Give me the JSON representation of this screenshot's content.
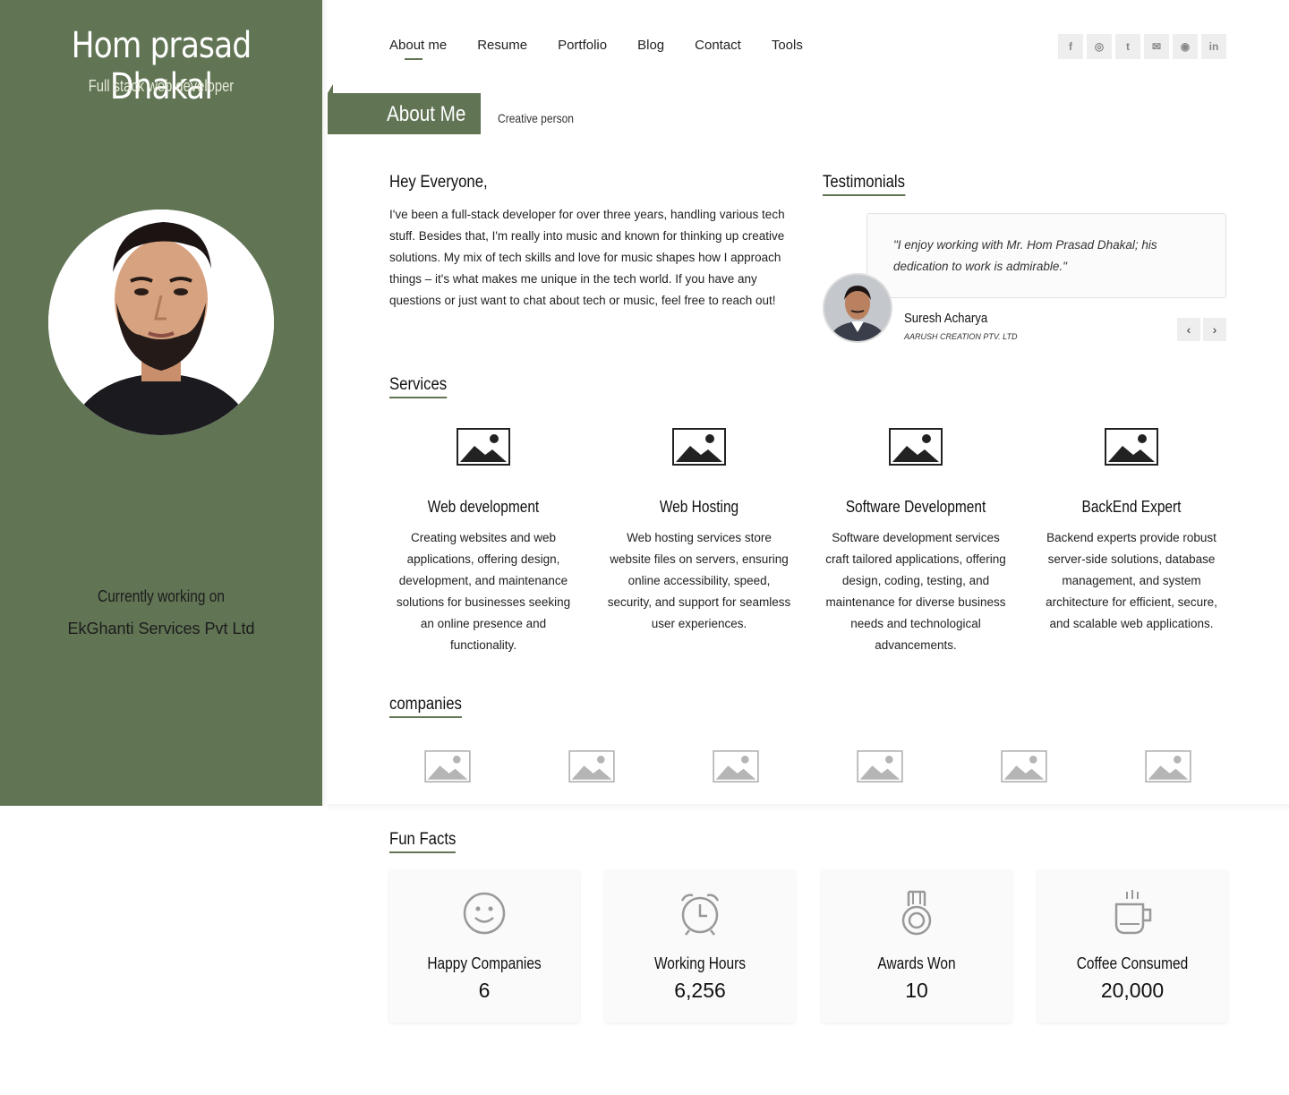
{
  "sidebar": {
    "name": "Hom prasad Dhakal",
    "role": "Full stack web developer",
    "work_label": "Currently working on",
    "work_company": "EkGhanti Services Pvt Ltd"
  },
  "nav": {
    "items": [
      {
        "label": "About me",
        "active": true
      },
      {
        "label": "Resume"
      },
      {
        "label": "Portfolio"
      },
      {
        "label": "Blog"
      },
      {
        "label": "Contact"
      },
      {
        "label": "Tools"
      }
    ]
  },
  "social": [
    {
      "icon": "facebook-icon",
      "glyph": "f"
    },
    {
      "icon": "instagram-icon",
      "glyph": "◎"
    },
    {
      "icon": "twitter-icon",
      "glyph": "t"
    },
    {
      "icon": "email-icon",
      "glyph": "✉"
    },
    {
      "icon": "github-icon",
      "glyph": "◉"
    },
    {
      "icon": "linkedin-icon",
      "glyph": "in"
    }
  ],
  "banner": {
    "title": "About Me",
    "subtitle": "Creative person"
  },
  "intro": {
    "heading": "Hey Everyone,",
    "text": "I've been a full-stack developer for over three years, handling various tech stuff. Besides that, I'm really into music and known for thinking up creative solutions. My mix of tech skills and love for music shapes how I approach things – it's what makes me unique in the tech world. If you have any questions or just want to chat about tech or music, feel free to reach out!"
  },
  "testimonials": {
    "title": "Testimonials",
    "quote": "\"I enjoy working with Mr. Hom Prasad Dhakal; his dedication to work is admirable.\"",
    "name": "Suresh Acharya",
    "company": "AARUSH CREATION PTV. LTD"
  },
  "services": {
    "title": "Services",
    "items": [
      {
        "title": "Web development",
        "desc": "Creating websites and web applications, offering design, development, and maintenance solutions for businesses seeking an online presence and functionality."
      },
      {
        "title": "Web Hosting",
        "desc": "Web hosting services store website files on servers, ensuring online accessibility, speed, security, and support for seamless user experiences."
      },
      {
        "title": "Software Development",
        "desc": "Software development services craft tailored applications, offering design, coding, testing, and maintenance for diverse business needs and technological advancements."
      },
      {
        "title": "BackEnd Expert",
        "desc": "Backend experts provide robust server-side solutions, database management, and system architecture for efficient, secure, and scalable web applications."
      }
    ]
  },
  "companies": {
    "title": "companies",
    "count": 6
  },
  "funfacts": {
    "title": "Fun Facts",
    "items": [
      {
        "label": "Happy Companies",
        "value": "6",
        "icon": "smiley-icon"
      },
      {
        "label": "Working Hours",
        "value": "6,256",
        "icon": "alarm-clock-icon"
      },
      {
        "label": "Awards Won",
        "value": "10",
        "icon": "medal-icon"
      },
      {
        "label": "Coffee Consumed",
        "value": "20,000",
        "icon": "coffee-cup-icon"
      }
    ]
  },
  "colors": {
    "accent": "#617454",
    "sidebar_text": "#ffffff"
  }
}
